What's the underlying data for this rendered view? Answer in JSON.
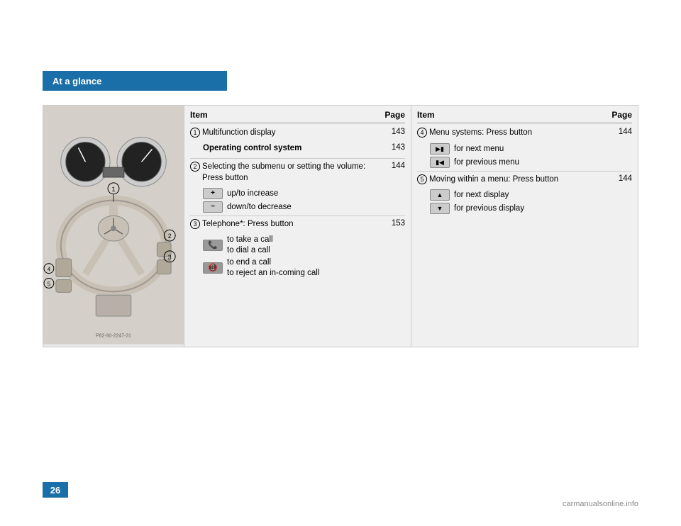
{
  "header": {
    "title": "At a glance"
  },
  "page_number": "26",
  "footer_site": "carmanualsonline.info",
  "left_table": {
    "col_item": "Item",
    "col_page": "Page",
    "rows": [
      {
        "num": "1",
        "desc": "Multifunction display",
        "page": "143",
        "subitems": []
      },
      {
        "num": "",
        "desc_bold": "Operating control system",
        "desc_normal": "",
        "page": "143",
        "subitems": []
      },
      {
        "num": "2",
        "desc": "Selecting the submenu or setting the volume: Press button",
        "page": "144",
        "subitems": [
          {
            "icon": "+",
            "text": "up/to increase"
          },
          {
            "icon": "−",
            "text": "down/to decrease"
          }
        ]
      },
      {
        "num": "3",
        "desc": "Telephone*: Press button",
        "page": "153",
        "subitems": [
          {
            "icon": "☎",
            "text1": "to take a call",
            "text2": "to dial a call"
          },
          {
            "icon": "☎",
            "text1": "to end a call",
            "text2": "to reject an in-coming call"
          }
        ]
      }
    ]
  },
  "right_table": {
    "col_item": "Item",
    "col_page": "Page",
    "rows": [
      {
        "num": "4",
        "desc": "Menu systems: Press button",
        "page": "144",
        "subitems": [
          {
            "icon": "▶",
            "text": "for next menu"
          },
          {
            "icon": "◀",
            "text": "for previous menu"
          }
        ]
      },
      {
        "num": "5",
        "desc": "Moving within a menu: Press button",
        "page": "144",
        "subitems": [
          {
            "icon": "▲",
            "text": "for next display"
          },
          {
            "icon": "▼",
            "text": "for previous display"
          }
        ]
      }
    ]
  },
  "image_caption": "P82-90-2247-31"
}
